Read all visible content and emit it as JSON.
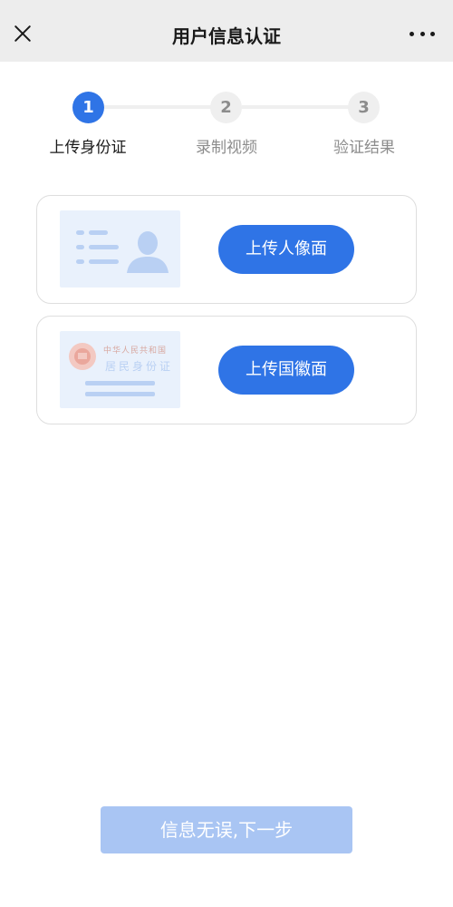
{
  "header": {
    "title": "用户信息认证",
    "close_icon": "close-icon",
    "more_icon": "more-dots-icon"
  },
  "steps": [
    {
      "number": "1",
      "label": "上传身份证",
      "active": true
    },
    {
      "number": "2",
      "label": "录制视频",
      "active": false
    },
    {
      "number": "3",
      "label": "验证结果",
      "active": false
    }
  ],
  "cards": [
    {
      "button_label": "上传人像面",
      "image": "id-card-portrait-side"
    },
    {
      "button_label": "上传国徽面",
      "image": "id-card-emblem-side",
      "emblem_line1": "中华人民共和国",
      "emblem_line2": "居民身份证"
    }
  ],
  "footer": {
    "next_button_label": "信息无误,下一步"
  },
  "colors": {
    "accent": "#2f74e6",
    "disabled_button": "#a9c5f3",
    "header_bg": "#ededed",
    "card_image_bg": "#e9f1fc"
  }
}
